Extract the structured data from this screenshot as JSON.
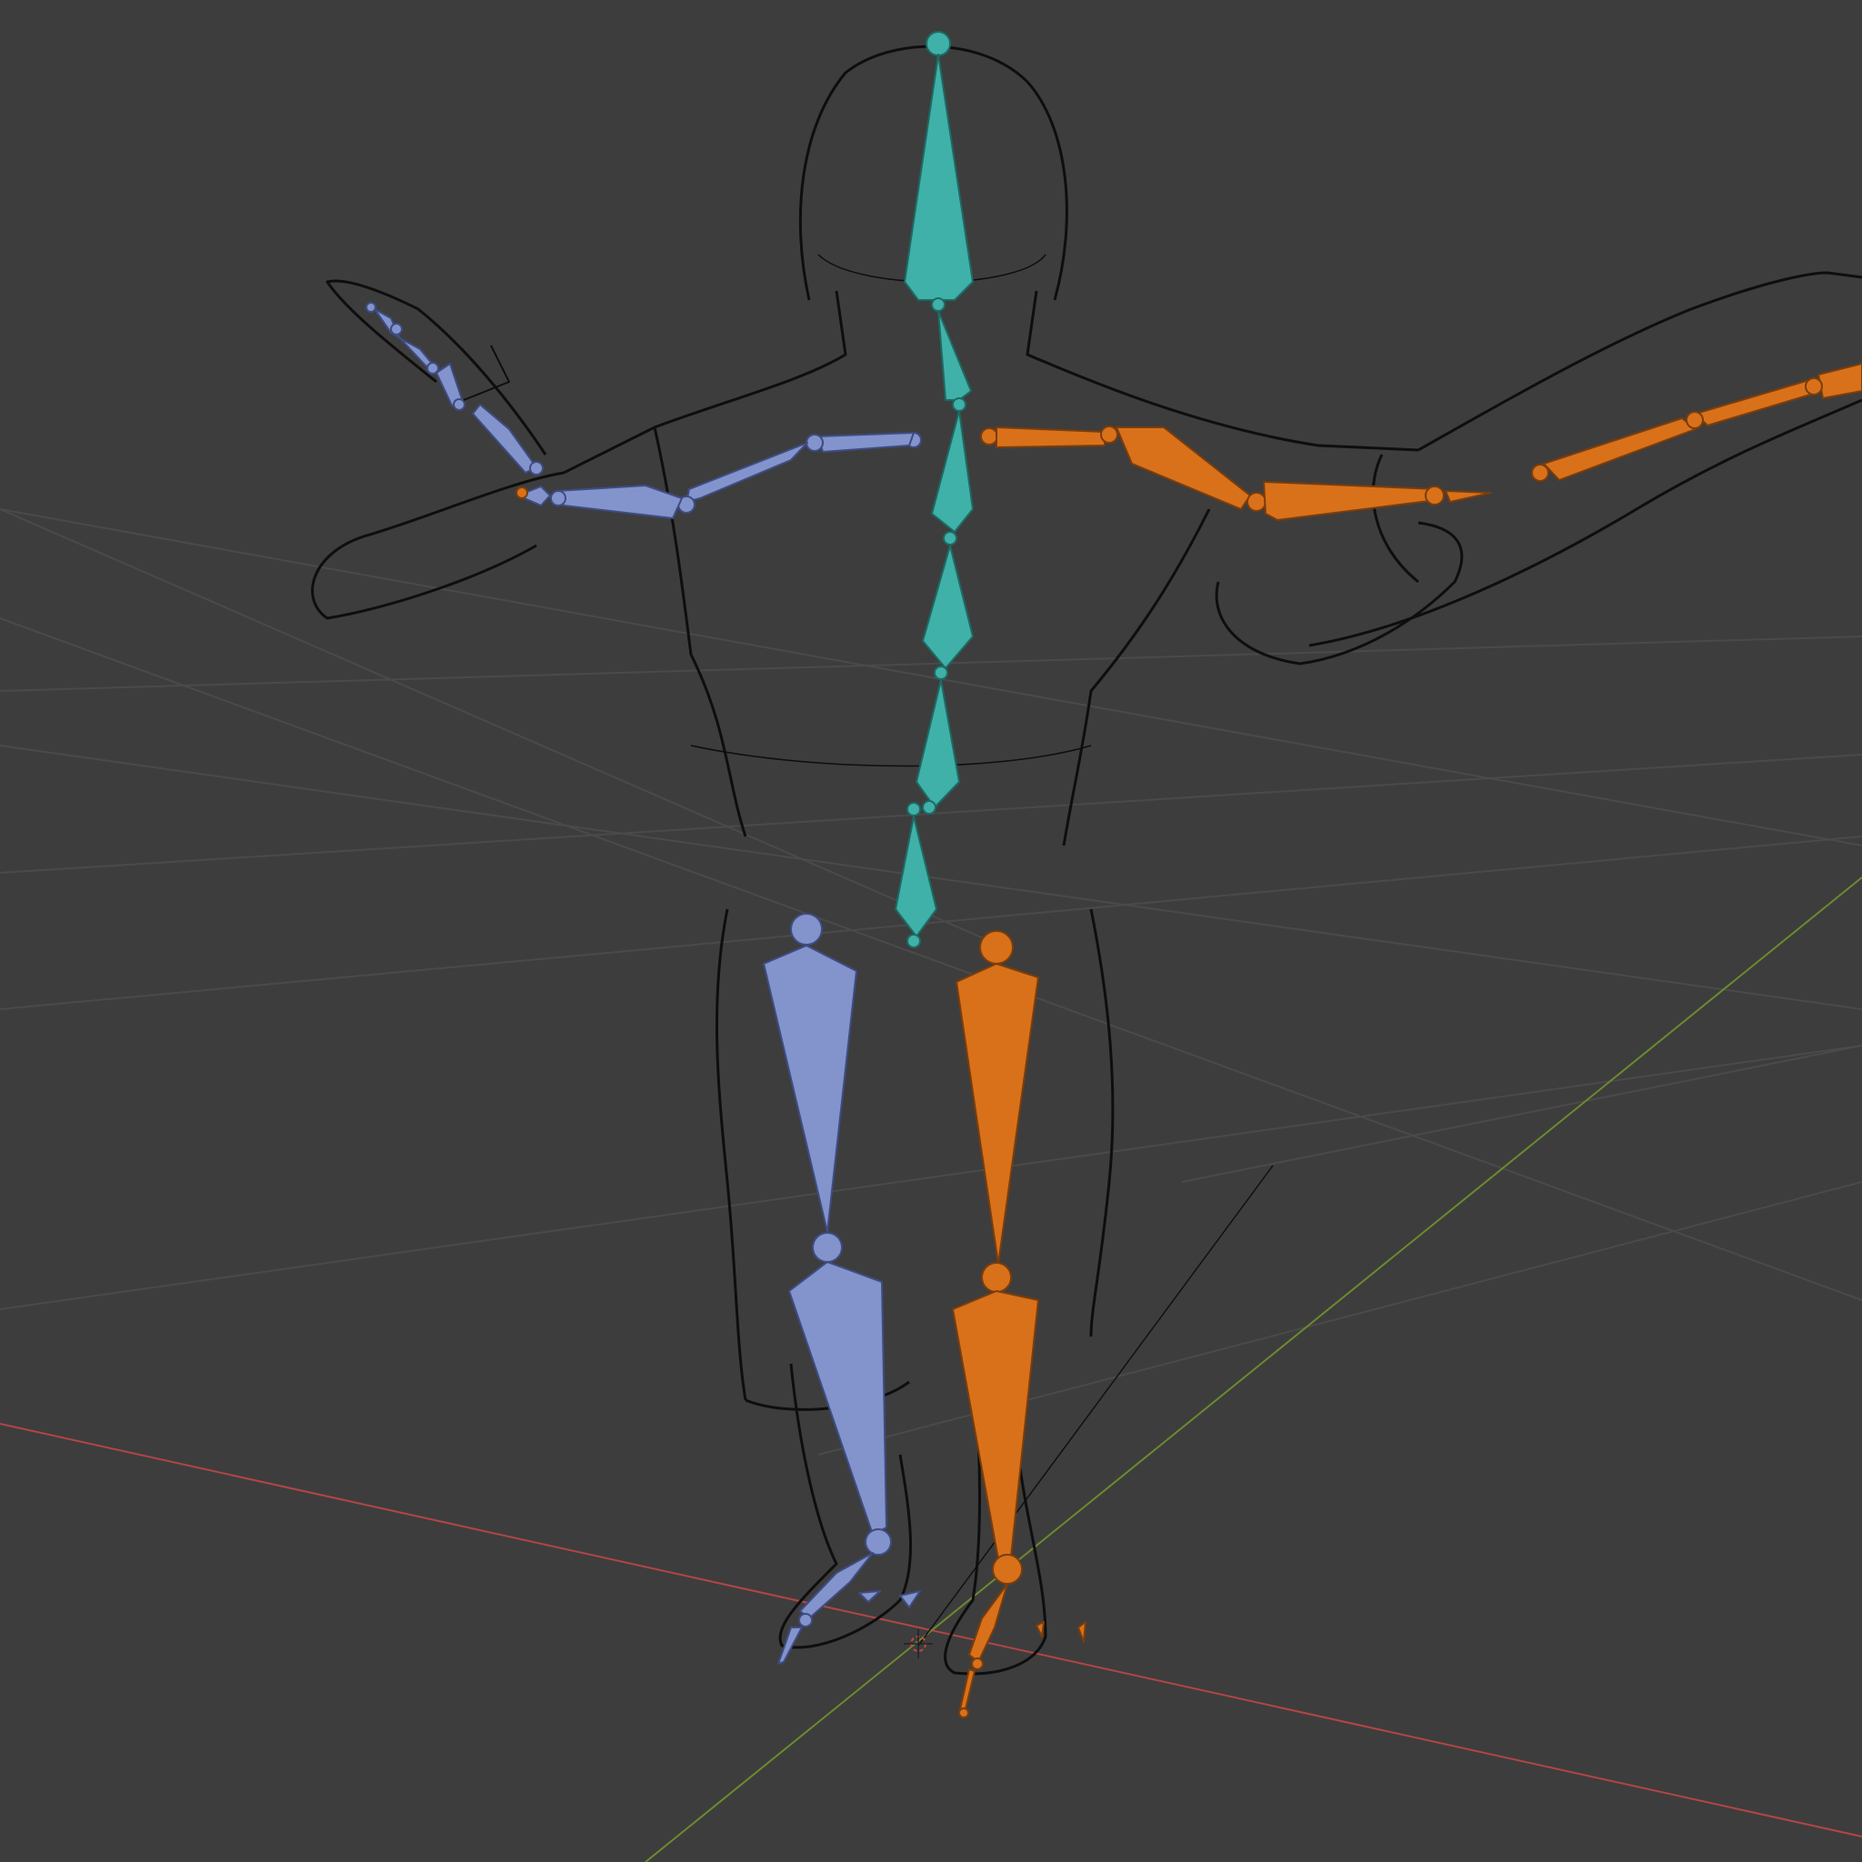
{
  "viewport": {
    "shading_mode": "wireframe",
    "background_color": "#3d3d3d",
    "grid_color": "#4a4a4a",
    "x_axis_color": "#b34545",
    "y_axis_color": "#6b8a2e",
    "wireframe_color": "#0e0e0e"
  },
  "armature": {
    "bone_groups": [
      {
        "name": "spine",
        "color": "#3fb1a8"
      },
      {
        "name": "left",
        "color": "#8393cc"
      },
      {
        "name": "right",
        "color": "#d9711a"
      }
    ]
  }
}
